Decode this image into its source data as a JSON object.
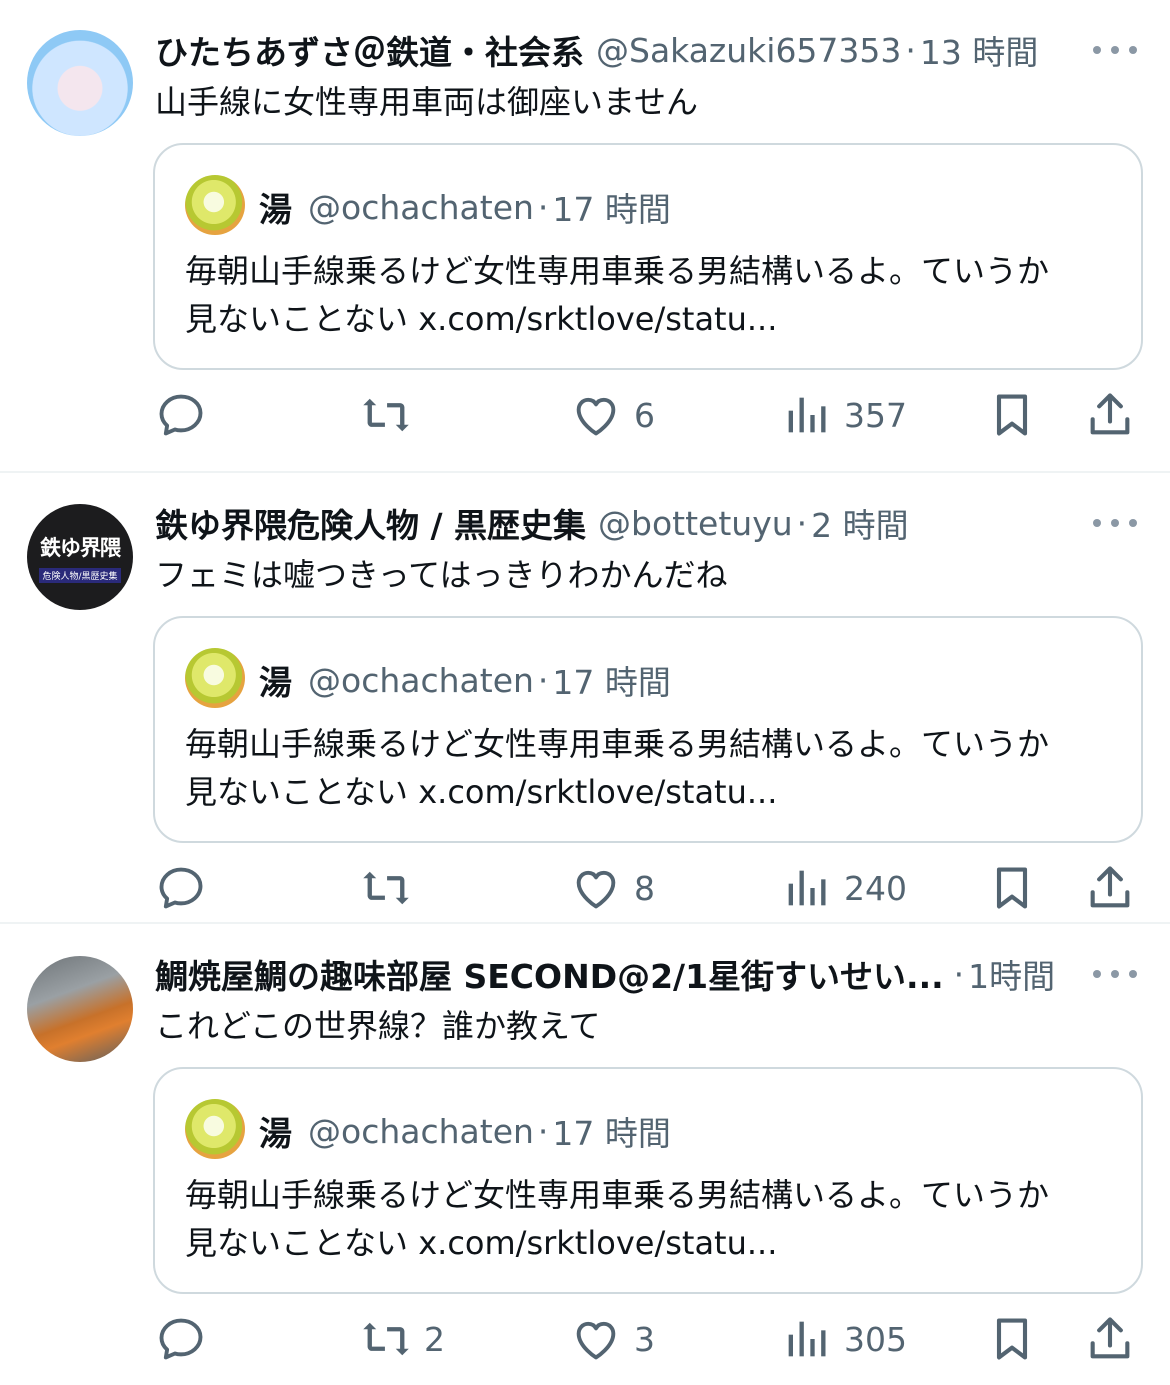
{
  "tweets": [
    {
      "name": "ひたちあずさ＠鉄道・社会系",
      "handle": "@Sakazuki657353",
      "time": "13 時間",
      "text": "山手線に女性専用車両は御座いません",
      "quote": {
        "name": "湯",
        "handle": "@ochachaten",
        "time": "17 時間",
        "text_line1": "毎朝山手線乗るけど女性専用車乗る男結構いるよ。ていうか",
        "text_line2": "見ないことない x.com/srktlove/statu..."
      },
      "replies": "",
      "retweets": "",
      "likes": "6",
      "views": "357"
    },
    {
      "name": "鉄ゆ界隈危険人物 / 黒歴史集",
      "handle": "@bottetuyu",
      "time": "2 時間",
      "text": "フェミは嘘つきってはっきりわかんだね",
      "avatar_text_big": "鉄ゆ界隈",
      "avatar_text_small": "危険人物/黒歴史集",
      "quote": {
        "name": "湯",
        "handle": "@ochachaten",
        "time": "17 時間",
        "text_line1": "毎朝山手線乗るけど女性専用車乗る男結構いるよ。ていうか",
        "text_line2": "見ないことない x.com/srktlove/statu..."
      },
      "replies": "",
      "retweets": "",
      "likes": "8",
      "views": "240"
    },
    {
      "name": "鯛焼屋鯛の趣味部屋 SECOND@2/1星街すいせい...",
      "handle": "",
      "time": "1時間",
      "text": "これどこの世界線？誰か教えて",
      "quote": {
        "name": "湯",
        "handle": "@ochachaten",
        "time": "17 時間",
        "text_line1": "毎朝山手線乗るけど女性専用車乗る男結構いるよ。ていうか",
        "text_line2": "見ないことない x.com/srktlove/statu..."
      },
      "replies": "",
      "retweets": "2",
      "likes": "3",
      "views": "305"
    }
  ],
  "separator": "·",
  "icons": [
    "reply-icon",
    "retweet-icon",
    "like-icon",
    "views-icon",
    "bookmark-icon",
    "share-icon",
    "more-icon"
  ],
  "colors": {
    "text": "#0f1419",
    "secondary": "#536471",
    "border": "#cfd9de",
    "divider": "#eff3f4"
  }
}
